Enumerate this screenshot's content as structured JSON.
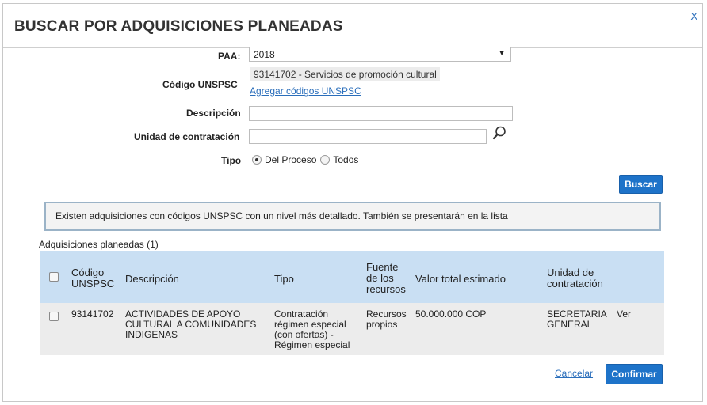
{
  "dialog": {
    "title": "BUSCAR POR ADQUISICIONES PLANEADAS",
    "close_label": "X"
  },
  "form": {
    "paa_label": "PAA:",
    "paa_value": "2018",
    "unspsc_label": "Código UNSPSC",
    "unspsc_tag": "93141702 - Servicios de promoción cultural",
    "add_codes_link": "Agregar códigos UNSPSC",
    "description_label": "Descripción",
    "description_value": "",
    "unit_label": "Unidad de contratación",
    "unit_value": "",
    "tipo_label": "Tipo",
    "tipo_options": [
      "Del Proceso",
      "Todos"
    ],
    "tipo_selected": "Del Proceso",
    "search_button": "Buscar"
  },
  "notice": "Existen adquisiciones con códigos UNSPSC con un nivel más detallado. También se presentarán en la lista",
  "results": {
    "title": "Adquisiciones planeadas (1)",
    "columns": {
      "code": [
        "Código",
        "UNSPSC"
      ],
      "description": "Descripción",
      "type": "Tipo",
      "source": [
        "Fuente",
        "de los",
        "recursos"
      ],
      "value": "Valor total estimado",
      "unit": [
        "Unidad de",
        "contratación"
      ]
    },
    "rows": [
      {
        "code": "93141702",
        "description": [
          "ACTIVIDADES DE APOYO",
          "CULTURAL A COMUNIDADES",
          "INDIGENAS"
        ],
        "type": [
          "Contratación",
          "régimen especial",
          "(con ofertas) -",
          "Régimen especial"
        ],
        "source": [
          "Recursos",
          "propios"
        ],
        "value": "50.000.000 COP",
        "unit": [
          "SECRETARIA",
          "GENERAL"
        ],
        "action": "Ver"
      }
    ]
  },
  "footer": {
    "cancel": "Cancelar",
    "confirm": "Confirmar"
  },
  "colors": {
    "primary": "#1e73c9",
    "link": "#2a6ebb",
    "header_row": "#c9dff3"
  },
  "icons": {
    "search": "magnifier-icon",
    "dropdown": "caret-down-icon"
  }
}
